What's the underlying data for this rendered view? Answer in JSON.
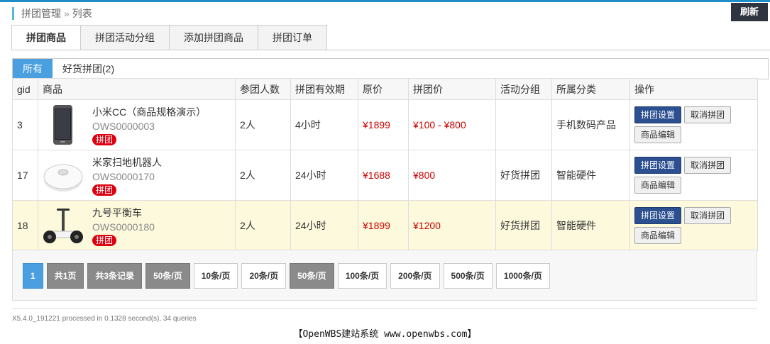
{
  "breadcrumb": {
    "section": "拼团管理",
    "separator": "»",
    "page": "列表"
  },
  "refresh_label": "刷新",
  "tabs": [
    {
      "label": "拼团商品",
      "active": true
    },
    {
      "label": "拼团活动分组"
    },
    {
      "label": "添加拼团商品"
    },
    {
      "label": "拼团订单"
    }
  ],
  "subtabs": [
    {
      "label": "所有",
      "active": true
    },
    {
      "label": "好货拼团(2)"
    }
  ],
  "columns": [
    "gid",
    "商品",
    "参团人数",
    "拼团有效期",
    "原价",
    "拼团价",
    "活动分组",
    "所属分类",
    "操作"
  ],
  "rows": [
    {
      "gid": "3",
      "name": "小米CC（商品规格演示）",
      "code": "OWS0000003",
      "badge": "拼团",
      "image": "phone-image",
      "people": "2人",
      "validity": "4小时",
      "orig_price": "¥1899",
      "group_price": "¥100 - ¥800",
      "group": "",
      "category": "手机数码产品",
      "btn_setting": "拼团设置",
      "btn_cancel": "取消拼团",
      "btn_edit": "商品编辑"
    },
    {
      "gid": "17",
      "name": "米家扫地机器人",
      "code": "OWS0000170",
      "badge": "拼团",
      "image": "robot-vacuum-image",
      "people": "2人",
      "validity": "24小时",
      "orig_price": "¥1688",
      "group_price": "¥800",
      "group": "好货拼团",
      "category": "智能硬件",
      "btn_setting": "拼团设置",
      "btn_cancel": "取消拼团",
      "btn_edit": "商品编辑"
    },
    {
      "gid": "18",
      "name": "九号平衡车",
      "code": "OWS0000180",
      "badge": "拼团",
      "image": "balance-scooter-image",
      "people": "2人",
      "validity": "24小时",
      "orig_price": "¥1899",
      "group_price": "¥1200",
      "group": "好货拼团",
      "category": "智能硬件",
      "btn_setting": "拼团设置",
      "btn_cancel": "取消拼团",
      "btn_edit": "商品编辑"
    }
  ],
  "pager": {
    "current": "1",
    "total_pages": "共1页",
    "total_records": "共3条记录",
    "per_page_current": "50条/页",
    "options": [
      "10条/页",
      "20条/页",
      "50条/页",
      "100条/页",
      "200条/页",
      "500条/页",
      "1000条/页"
    ]
  },
  "footer": {
    "info": "X5.4.0_191221 processed in 0.1328 second(s), 34 queries",
    "brand": "【OpenWBS建站系统 www.openwbs.com】"
  },
  "colors": {
    "accent": "#4a9fe0",
    "price": "#cc0000",
    "primary_button": "#2b4f8f",
    "highlight_row": "#fcf9dc"
  }
}
